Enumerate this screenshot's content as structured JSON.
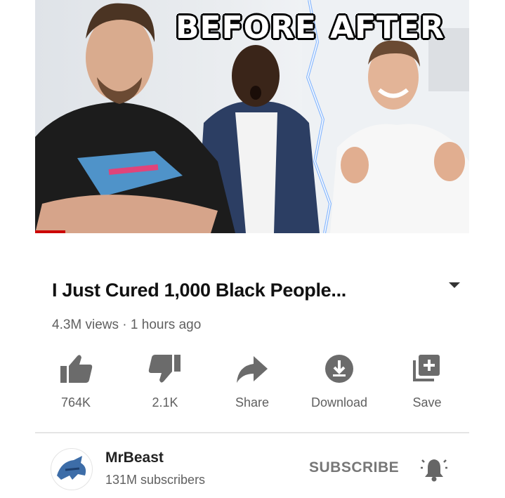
{
  "thumbnail": {
    "before_text": "BEFORE",
    "after_text": "AFTER",
    "progress_fraction": 0.07
  },
  "video": {
    "title": "I Just Cured 1,000 Black People...",
    "meta": "4.3M views  · 1 hours ago"
  },
  "actions": [
    {
      "icon": "thumbs-up-icon",
      "label": "764K"
    },
    {
      "icon": "thumbs-down-icon",
      "label": "2.1K"
    },
    {
      "icon": "share-icon",
      "label": "Share"
    },
    {
      "icon": "download-icon",
      "label": "Download"
    },
    {
      "icon": "save-playlist-icon",
      "label": "Save"
    }
  ],
  "channel": {
    "name": "MrBeast",
    "subscribers": "131M subscribers",
    "subscribe_label": "SUBSCRIBE",
    "avatar_icon": "channel-logo-icon"
  },
  "colors": {
    "accent": "#cc0000",
    "text_primary": "#111111",
    "text_secondary": "#606060",
    "icon": "#6b6b6b"
  }
}
